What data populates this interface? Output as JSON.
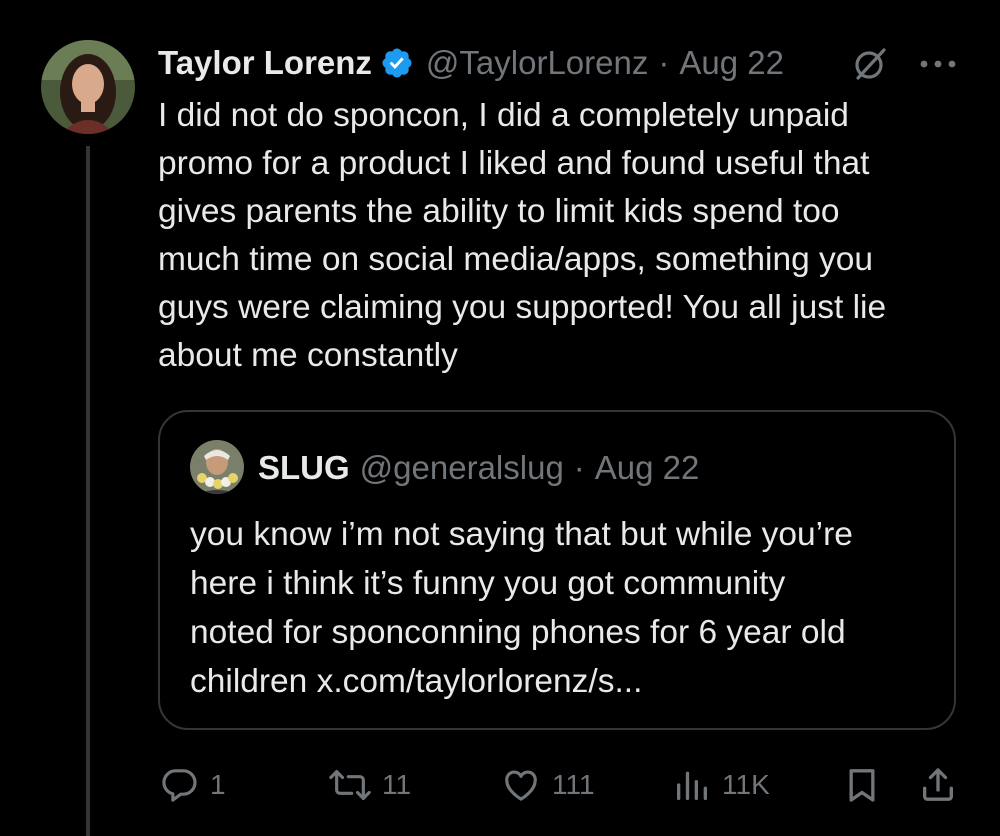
{
  "tweet": {
    "author_name": "Taylor Lorenz",
    "author_handle": "@TaylorLorenz",
    "separator": "·",
    "date": "Aug 22",
    "text_lines": [
      "I did not do sponcon, I did a completely unpaid",
      "promo for a product I liked and found useful that",
      "gives parents the ability to limit kids spend too",
      "much time on social media/apps, something you",
      "guys were claiming you supported! You all just lie",
      "about me constantly"
    ]
  },
  "quote": {
    "author_name": "SLUG",
    "author_handle": "@generalslug",
    "separator": "·",
    "date": "Aug 22",
    "text_lines": [
      "you know i’m not saying that but while you’re",
      "here i think it’s funny you got community",
      "noted for sponconning phones for 6 year old",
      "children x.com/taylorlorenz/s..."
    ]
  },
  "actions": {
    "replies": "1",
    "reposts": "11",
    "likes": "111",
    "views": "11K"
  },
  "icons": {
    "verified": "verified-badge-icon",
    "grok": "grok-icon",
    "more": "more-icon",
    "reply": "reply-icon",
    "repost": "repost-icon",
    "like": "like-icon",
    "views": "views-icon",
    "bookmark": "bookmark-icon",
    "share": "share-icon"
  },
  "colors": {
    "background": "#000000",
    "text_primary": "#e7e9ea",
    "text_secondary": "#71767b",
    "border": "#333639",
    "verified_blue": "#1d9bf0"
  }
}
